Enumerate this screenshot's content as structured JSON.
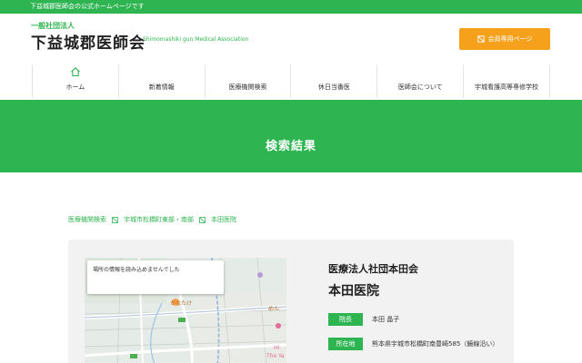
{
  "topbar": {
    "text": "下益城郡医師会の公式ホームページです"
  },
  "header": {
    "org_sub": "一般社団法人",
    "org_name": "下益城郡医師会",
    "org_en": "Shimomashiki gun Medical Association",
    "member_button": "会員専用ページ"
  },
  "nav": {
    "items": [
      {
        "label": "ホーム",
        "icon": "home-icon"
      },
      {
        "label": "新着情報"
      },
      {
        "label": "医療機関検索"
      },
      {
        "label": "休日当番医"
      },
      {
        "label": "医師会について"
      },
      {
        "label": "宇城看護高等専修学校"
      }
    ]
  },
  "banner": {
    "title": "検索結果"
  },
  "breadcrumb": {
    "items": [
      "医療機関検索",
      "宇城市松橋町東部・南部",
      "本田医院"
    ]
  },
  "map": {
    "error": "場所の情報を読み込めませんでした",
    "labels": [
      "かなたけ",
      "めん",
      "HI",
      "The Ya"
    ]
  },
  "clinic": {
    "corporation": "医療法人社団本田会",
    "name": "本田医院",
    "director_label": "院長",
    "director": "本田 晶子",
    "address_label": "所在地",
    "address": "熊本県宇城市松橋町南豊崎585（鏡線沿い）"
  },
  "colors": {
    "brand": "#2eb451",
    "accent": "#f5a11c"
  }
}
